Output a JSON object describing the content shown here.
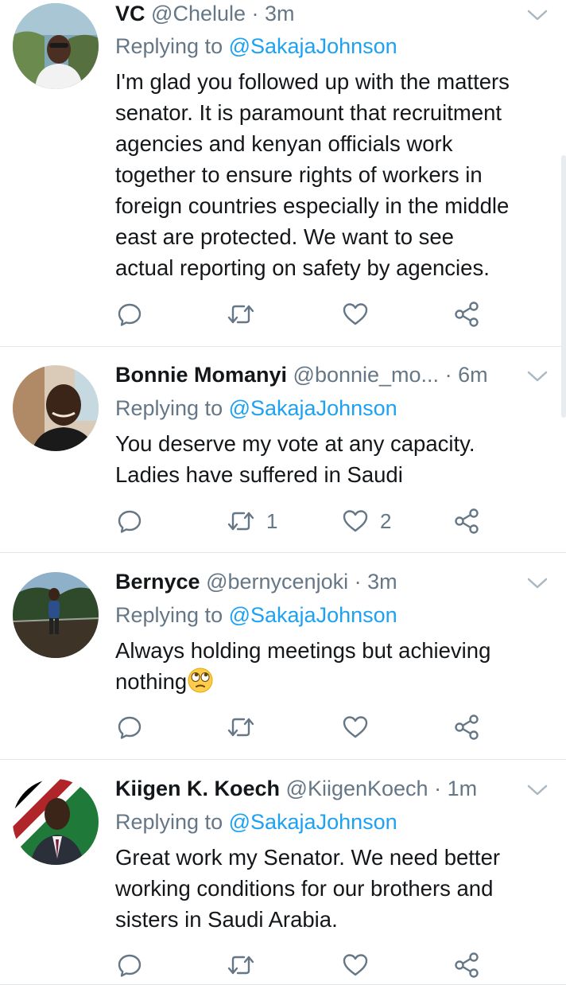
{
  "tweets": [
    {
      "name": "VC",
      "handle": "@Chelule",
      "separator": "·",
      "time": "3m",
      "replying_prefix": "Replying to",
      "replying_to": "@SakajaJohnson",
      "lines": [
        "I'm glad you followed up with the matters",
        "senator. It is paramount that recruitment",
        "agencies and kenyan officials work",
        "together to ensure rights of workers in",
        "foreign countries especially in the middle",
        "east are protected. We want to see",
        "actual reporting on safety by agencies."
      ],
      "retweets": "",
      "likes": ""
    },
    {
      "name": "Bonnie Momanyi",
      "handle": "@bonnie_mo...",
      "separator": "·",
      "time": "6m",
      "replying_prefix": "Replying to",
      "replying_to": "@SakajaJohnson",
      "lines": [
        "You deserve my vote at any capacity.",
        "Ladies have suffered in Saudi"
      ],
      "retweets": "1",
      "likes": "2"
    },
    {
      "name": "Bernyce",
      "handle": "@bernycenjoki",
      "separator": "·",
      "time": "3m",
      "replying_prefix": "Replying to",
      "replying_to": "@SakajaJohnson",
      "lines": [
        "Always holding meetings but achieving",
        "nothing"
      ],
      "retweets": "",
      "likes": ""
    },
    {
      "name": "Kiigen K. Koech",
      "handle": "@KiigenKoech",
      "separator": "·",
      "time": "1m",
      "replying_prefix": "Replying to",
      "replying_to": "@SakajaJohnson",
      "lines": [
        "Great work my Senator. We need better",
        "working conditions for our brothers and",
        "sisters in Saudi Arabia."
      ],
      "retweets": "",
      "likes": ""
    }
  ],
  "icons": {
    "reply": "reply-icon",
    "retweet": "retweet-icon",
    "like": "heart-icon",
    "share": "share-icon",
    "menu": "chevron-down-icon",
    "emoji": "face-with-rolling-eyes"
  },
  "colors": {
    "link": "#1da1f2",
    "muted": "#657786",
    "text": "#14171a",
    "divider": "#e1e8ed"
  }
}
